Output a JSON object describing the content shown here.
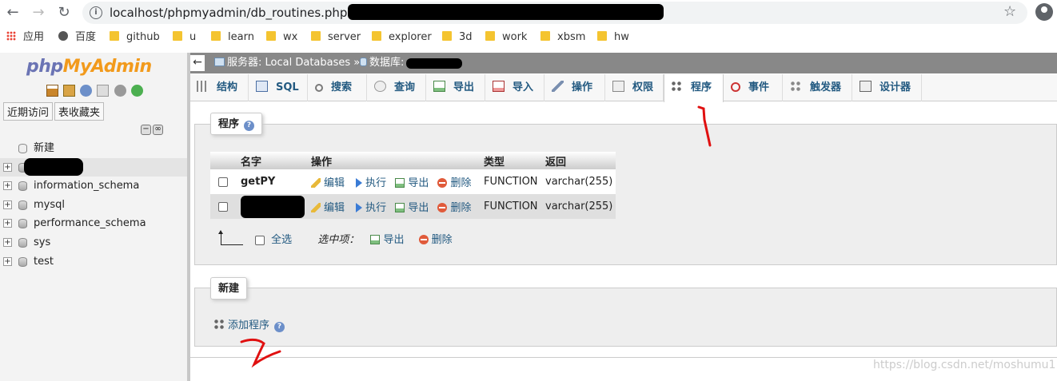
{
  "browser": {
    "url": "localhost/phpmyadmin/db_routines.php?db=",
    "bookmarks": [
      "应用",
      "百度",
      "github",
      "u",
      "learn",
      "wx",
      "server",
      "explorer",
      "3d",
      "work",
      "xbsm",
      "hw"
    ]
  },
  "sidebar": {
    "logo": {
      "php": "php",
      "my": "MyAdmin"
    },
    "tabs": [
      "近期访问",
      "表收藏夹"
    ],
    "new_label": "新建",
    "databases": [
      "information_schema",
      "mysql",
      "performance_schema",
      "sys",
      "test"
    ]
  },
  "breadcrumb": {
    "server": "服务器: Local Databases »",
    "database": "数据库:"
  },
  "tabs": [
    {
      "label": "结构",
      "icon": "structure-icon"
    },
    {
      "label": "SQL",
      "icon": "sql-icon"
    },
    {
      "label": "搜索",
      "icon": "search-icon"
    },
    {
      "label": "查询",
      "icon": "query-icon"
    },
    {
      "label": "导出",
      "icon": "export-icon"
    },
    {
      "label": "导入",
      "icon": "import-icon"
    },
    {
      "label": "操作",
      "icon": "wrench-icon"
    },
    {
      "label": "权限",
      "icon": "privileges-icon"
    },
    {
      "label": "程序",
      "icon": "routines-icon"
    },
    {
      "label": "事件",
      "icon": "clock-icon"
    },
    {
      "label": "触发器",
      "icon": "triggers-icon"
    },
    {
      "label": "设计器",
      "icon": "designer-icon"
    }
  ],
  "routines": {
    "legend": "程序",
    "columns": [
      "名字",
      "操作",
      "类型",
      "返回"
    ],
    "rows": [
      {
        "name": "getPY",
        "type": "FUNCTION",
        "returns": "varchar(255)"
      },
      {
        "name": "",
        "type": "FUNCTION",
        "returns": "varchar(255)"
      }
    ],
    "actions": {
      "edit": "编辑",
      "execute": "执行",
      "export": "导出",
      "drop": "删除"
    },
    "check_all": "全选",
    "with_selected": "选中项：",
    "bulk_export": "导出",
    "bulk_drop": "删除"
  },
  "new_section": {
    "legend": "新建",
    "add_routine": "添加程序"
  },
  "watermark": "https://blog.csdn.net/moshumu1"
}
